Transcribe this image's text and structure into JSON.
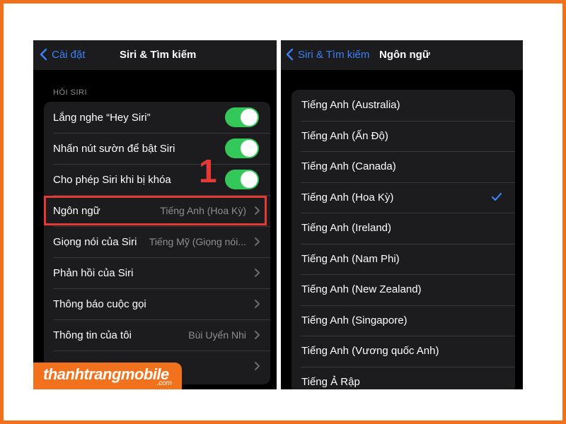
{
  "colors": {
    "accent": "#f2711c",
    "ios_blue": "#3b82f6",
    "toggle_on": "#34c759",
    "highlight_red": "#e53935"
  },
  "left": {
    "nav": {
      "back_label": "Cài đặt",
      "title": "Siri & Tìm kiếm"
    },
    "section_header": "HỎI SIRI",
    "step_number": "1",
    "rows": [
      {
        "label": "Lắng nghe “Hey Siri”",
        "toggle_on": true
      },
      {
        "label": "Nhấn nút sườn để bật Siri",
        "toggle_on": true
      },
      {
        "label": "Cho phép Siri khi bị khóa",
        "toggle_on": true
      },
      {
        "label": "Ngôn ngữ",
        "value": "Tiếng Anh (Hoa Kỳ)"
      },
      {
        "label": "Giọng nói của Siri",
        "value": "Tiếng Mỹ (Giọng nói..."
      },
      {
        "label": "Phản hồi của Siri"
      },
      {
        "label": "Thông báo cuộc gọi"
      },
      {
        "label": "Thông tin của tôi",
        "value": "Bùi Uyển Nhi"
      },
      {
        "label": ""
      }
    ]
  },
  "right": {
    "nav": {
      "back_label": "Siri & Tìm kiếm",
      "title": "Ngôn ngữ"
    },
    "languages": [
      "Tiếng Anh (Australia)",
      "Tiếng Anh (Ấn Độ)",
      "Tiếng Anh (Canada)",
      "Tiếng Anh (Hoa Kỳ)",
      "Tiếng Anh (Ireland)",
      "Tiếng Anh (Nam Phi)",
      "Tiếng Anh (New Zealand)",
      "Tiếng Anh (Singapore)",
      "Tiếng Anh (Vương quốc Anh)",
      "Tiếng Ả Rập"
    ],
    "selected_language": "Tiếng Anh (Hoa Kỳ)"
  },
  "watermark": {
    "brand": "thanhtrangmobile",
    "suffix": ".com"
  },
  "icons": [
    "chevron-left-icon",
    "chevron-right-icon",
    "checkmark-icon"
  ]
}
